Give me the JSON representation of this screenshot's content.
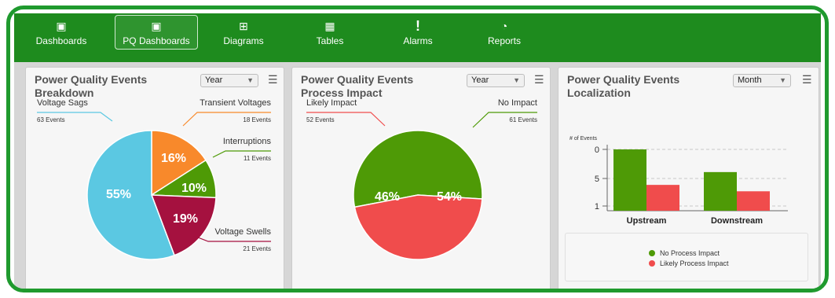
{
  "nav": {
    "items": [
      {
        "label": "Dashboards",
        "icon": "monitor-chart-icon",
        "glyph": "▣"
      },
      {
        "label": "PQ Dashboards",
        "icon": "monitor-chart-icon",
        "glyph": "▣"
      },
      {
        "label": "Diagrams",
        "icon": "hierarchy-icon",
        "glyph": "⊞"
      },
      {
        "label": "Tables",
        "icon": "table-icon",
        "glyph": "▦"
      },
      {
        "label": "Alarms",
        "icon": "exclamation-icon",
        "glyph": "!"
      },
      {
        "label": "Reports",
        "icon": "reports-icon",
        "glyph": "◔"
      }
    ],
    "active_index": 1
  },
  "colors": {
    "frame": "#1f9a2e",
    "nav": "#1e8b1e",
    "blue": "#5bc8e2",
    "orange": "#f8892b",
    "green": "#4e9a06",
    "maroon": "#a5113f",
    "red": "#f04c4c"
  },
  "panels": {
    "breakdown": {
      "title_line1": "Power Quality Events",
      "title_line2": "Breakdown",
      "select_value": "Year",
      "menu_glyph": "☰"
    },
    "impact": {
      "title_line1": "Power Quality Events",
      "title_line2": "Process Impact",
      "select_value": "Year",
      "menu_glyph": "☰"
    },
    "localization": {
      "title_line1": "Power Quality Events",
      "title_line2": "Localization",
      "select_value": "Month",
      "menu_glyph": "☰"
    }
  },
  "chart_data": [
    {
      "type": "pie",
      "slices": [
        {
          "name": "Voltage Sags",
          "value": 63,
          "unit_label": "63 Events",
          "percent": "55%",
          "color": "#5bc8e2"
        },
        {
          "name": "Transient Voltages",
          "value": 18,
          "unit_label": "18 Events",
          "percent": "16%",
          "color": "#f8892b"
        },
        {
          "name": "Interruptions",
          "value": 11,
          "unit_label": "11 Events",
          "percent": "10%",
          "color": "#4e9a06"
        },
        {
          "name": "Voltage Swells",
          "value": 21,
          "unit_label": "21 Events",
          "percent": "19%",
          "color": "#a5113f"
        }
      ]
    },
    {
      "type": "pie",
      "slices": [
        {
          "name": "No Impact",
          "value": 61,
          "unit_label": "61 Events",
          "percent": "54%",
          "color": "#4e9a06"
        },
        {
          "name": "Likely Impact",
          "value": 52,
          "unit_label": "52 Events",
          "percent": "46%",
          "color": "#f04c4c"
        }
      ]
    },
    {
      "type": "bar",
      "ylabel": "# of Events",
      "yticks": [
        "0",
        "5",
        "1"
      ],
      "categories": [
        "Upstream",
        "Downstream"
      ],
      "series": [
        {
          "name": "No Process Impact",
          "color": "#4e9a06",
          "values": [
            10,
            6.1
          ]
        },
        {
          "name": "Likely Process Impact",
          "color": "#f04c4c",
          "values": [
            3.9,
            2.8
          ]
        }
      ],
      "ylim": [
        0,
        10
      ],
      "grid": true,
      "legend_position": "bottom"
    }
  ]
}
